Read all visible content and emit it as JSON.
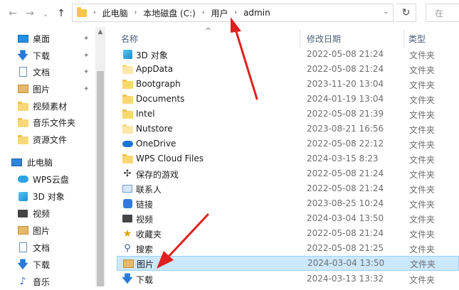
{
  "nav": {
    "back_glyph": "←",
    "forward_glyph": "→",
    "recent_glyph": "⌄",
    "up_glyph": "↑",
    "refresh_glyph": "↻"
  },
  "address": {
    "crumbs": [
      "此电脑",
      "本地磁盘 (C:)",
      "用户",
      "admin"
    ],
    "separator": "›",
    "dropdown_glyph": "⌄"
  },
  "search": {
    "hint": "在"
  },
  "sidebar": {
    "items": [
      {
        "label": "桌面",
        "icon": "desktop-icon",
        "pinned": true
      },
      {
        "label": "下载",
        "icon": "download-arrow-icon",
        "pinned": true
      },
      {
        "label": "文档",
        "icon": "document-icon",
        "pinned": true
      },
      {
        "label": "图片",
        "icon": "picture-icon",
        "pinned": true
      },
      {
        "label": "视频素材",
        "icon": "folder-icon",
        "pinned": false
      },
      {
        "label": "音乐文件夹",
        "icon": "folder-icon",
        "pinned": false
      },
      {
        "label": "资源文件",
        "icon": "folder-icon",
        "pinned": false
      },
      {
        "label": "此电脑",
        "icon": "computer-icon",
        "pinned": false
      },
      {
        "label": "WPS云盘",
        "icon": "wps-cloud-icon",
        "pinned": false
      },
      {
        "label": "3D 对象",
        "icon": "3d-objects-icon",
        "pinned": false
      },
      {
        "label": "视频",
        "icon": "video-icon",
        "pinned": false
      },
      {
        "label": "图片",
        "icon": "picture-icon",
        "pinned": false
      },
      {
        "label": "文档",
        "icon": "document-icon",
        "pinned": false
      },
      {
        "label": "下载",
        "icon": "download-arrow-icon",
        "pinned": false
      },
      {
        "label": "音乐",
        "icon": "music-icon",
        "pinned": false
      }
    ],
    "pin_glyph": "📌"
  },
  "columns": {
    "name": "名称",
    "date": "修改日期",
    "type": "类型"
  },
  "files": [
    {
      "name": "3D 对象",
      "date": "2022-05-08 21:24",
      "type": "文件夹",
      "icon": "3d-objects-icon"
    },
    {
      "name": "AppData",
      "date": "2022-05-08 21:24",
      "type": "文件夹",
      "icon": "folder-icon"
    },
    {
      "name": "Bootgraph",
      "date": "2023-11-20 13:04",
      "type": "文件夹",
      "icon": "folder-icon"
    },
    {
      "name": "Documents",
      "date": "2024-01-19 13:04",
      "type": "文件夹",
      "icon": "folder-icon"
    },
    {
      "name": "Intel",
      "date": "2022-05-08 21:39",
      "type": "文件夹",
      "icon": "folder-icon"
    },
    {
      "name": "Nutstore",
      "date": "2023-08-21 16:56",
      "type": "文件夹",
      "icon": "folder-icon"
    },
    {
      "name": "OneDrive",
      "date": "2022-05-08 22:12",
      "type": "文件夹",
      "icon": "onedrive-cloud-icon"
    },
    {
      "name": "WPS Cloud Files",
      "date": "2024-03-15 8:23",
      "type": "文件夹",
      "icon": "folder-icon"
    },
    {
      "name": "保存的游戏",
      "date": "2022-05-08 21:24",
      "type": "文件夹",
      "icon": "saved-games-icon"
    },
    {
      "name": "联系人",
      "date": "2022-05-08 21:24",
      "type": "文件夹",
      "icon": "contacts-icon"
    },
    {
      "name": "链接",
      "date": "2023-08-25 10:24",
      "type": "文件夹",
      "icon": "links-icon"
    },
    {
      "name": "视频",
      "date": "2024-03-04 13:50",
      "type": "文件夹",
      "icon": "video-icon"
    },
    {
      "name": "收藏夹",
      "date": "2022-05-08 21:24",
      "type": "文件夹",
      "icon": "favorites-star-icon"
    },
    {
      "name": "搜索",
      "date": "2022-05-08 21:25",
      "type": "文件夹",
      "icon": "search-magnifier-icon"
    },
    {
      "name": "图片",
      "date": "2024-03-04 13:50",
      "type": "文件夹",
      "icon": "picture-icon",
      "selected": true
    },
    {
      "name": "下载",
      "date": "2024-03-13 13:32",
      "type": "文件夹",
      "icon": "download-arrow-icon"
    }
  ],
  "colors": {
    "selection_bg": "#cce8ff",
    "selection_border": "#99d1ff",
    "header_text": "#4c607a",
    "annotation_red": "#e02020",
    "folder_yellow": "#f8d775"
  }
}
